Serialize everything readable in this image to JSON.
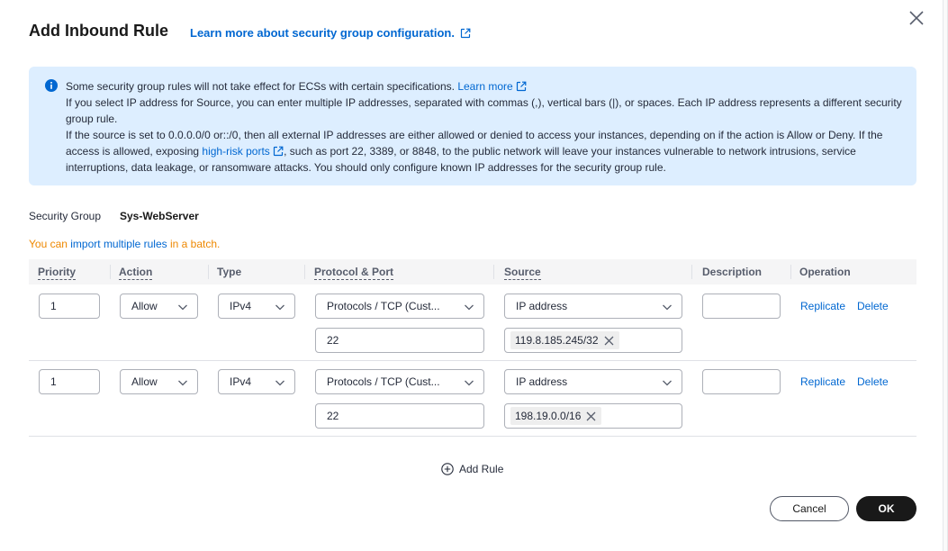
{
  "dialog": {
    "title": "Add Inbound Rule",
    "learn_link": "Learn more about security group configuration."
  },
  "info": {
    "line1": "Some security group rules will not take effect for ECSs with certain specifications.",
    "learn_more": "Learn more",
    "line2": "If you select IP address for Source, you can enter multiple IP addresses, separated with commas (,), vertical bars (|), or spaces. Each IP address represents a different security group rule.",
    "line3_a": "If the source is set to 0.0.0.0/0 or::/0, then all external IP addresses are either allowed or denied to access your instances, depending on if the action is Allow or Deny. If the access is allowed, exposing",
    "high_risk": "high-risk ports",
    "line3_b": ", such as port 22, 3389, or 8848, to the public network will leave your instances vulnerable to network intrusions, service interruptions, data leakage, or ransomware attacks. You should only configure known IP addresses for the security group rule."
  },
  "security_group": {
    "label": "Security Group",
    "value": "Sys-WebServer"
  },
  "import": {
    "prefix": "You can ",
    "link": "import multiple rules",
    "suffix": " in a batch."
  },
  "columns": {
    "priority": "Priority",
    "action": "Action",
    "type": "Type",
    "protocol": "Protocol & Port",
    "source": "Source",
    "description": "Description",
    "operation": "Operation"
  },
  "rules": [
    {
      "priority": "1",
      "action": "Allow",
      "type": "IPv4",
      "protocol": "Protocols / TCP (Cust...",
      "port": "22",
      "source_type": "IP address",
      "source_ip": "119.8.185.245/32",
      "description": "",
      "replicate": "Replicate",
      "delete": "Delete"
    },
    {
      "priority": "1",
      "action": "Allow",
      "type": "IPv4",
      "protocol": "Protocols / TCP (Cust...",
      "port": "22",
      "source_type": "IP address",
      "source_ip": "198.19.0.0/16",
      "description": "",
      "replicate": "Replicate",
      "delete": "Delete"
    }
  ],
  "add_rule": "Add Rule",
  "buttons": {
    "cancel": "Cancel",
    "ok": "OK"
  },
  "colors": {
    "link": "#0067d1",
    "info_bg": "#ddeeff",
    "warning": "#ee8800",
    "primary_button": "#191919"
  },
  "icons": {
    "close": "close-icon",
    "info": "info-icon",
    "external": "external-link-icon",
    "chevron": "chevron-down-icon",
    "add": "plus-circle-icon",
    "remove": "x-icon"
  }
}
